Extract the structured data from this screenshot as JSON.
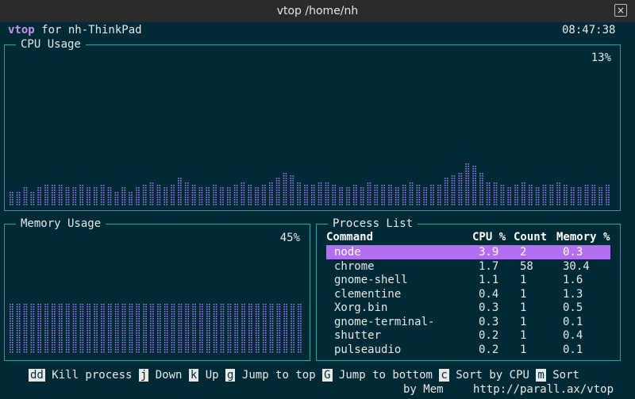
{
  "window": {
    "title": "vtop  /home/nh",
    "close_glyph": "×"
  },
  "header": {
    "app": "vtop",
    "host_text": " for nh-ThinkPad",
    "clock": "08:47:38"
  },
  "cpu": {
    "title": "CPU Usage",
    "percent_label": "13%",
    "history": [
      10,
      10,
      12,
      10,
      12,
      14,
      14,
      14,
      12,
      12,
      14,
      12,
      12,
      14,
      12,
      10,
      12,
      10,
      12,
      14,
      16,
      14,
      12,
      14,
      18,
      16,
      14,
      12,
      12,
      14,
      12,
      12,
      14,
      16,
      14,
      12,
      14,
      16,
      18,
      22,
      20,
      16,
      14,
      14,
      16,
      16,
      14,
      12,
      12,
      14,
      12,
      16,
      14,
      14,
      14,
      12,
      14,
      16,
      14,
      12,
      14,
      14,
      18,
      20,
      22,
      28,
      26,
      22,
      16,
      16,
      14,
      12,
      14,
      16,
      14,
      12,
      14,
      14,
      16,
      14,
      12,
      12,
      14,
      14,
      12,
      14
    ]
  },
  "memory": {
    "title": "Memory Usage",
    "percent_label": "45%",
    "history": [
      45,
      45,
      45,
      45,
      45,
      45,
      45,
      45,
      45,
      45,
      45,
      45,
      45,
      45,
      45,
      45,
      45,
      45,
      45,
      45,
      45,
      45,
      45,
      45,
      45,
      45,
      45,
      45,
      45,
      45,
      45,
      45,
      45,
      45,
      45,
      45,
      45,
      45,
      45,
      45,
      45,
      45
    ]
  },
  "processes": {
    "title": "Process List",
    "headers": {
      "command": "Command",
      "cpu": "CPU %",
      "count": "Count",
      "memory": "Memory %"
    },
    "rows": [
      {
        "command": "node",
        "cpu": "3.9",
        "count": "2",
        "memory": "0.3"
      },
      {
        "command": "chrome",
        "cpu": "1.7",
        "count": "58",
        "memory": "30.4"
      },
      {
        "command": "gnome-shell",
        "cpu": "1.1",
        "count": "1",
        "memory": "1.6"
      },
      {
        "command": "clementine",
        "cpu": "0.4",
        "count": "1",
        "memory": "1.3"
      },
      {
        "command": "Xorg.bin",
        "cpu": "0.3",
        "count": "1",
        "memory": "0.5"
      },
      {
        "command": "gnome-terminal-",
        "cpu": "0.3",
        "count": "1",
        "memory": "0.1"
      },
      {
        "command": "shutter",
        "cpu": "0.2",
        "count": "1",
        "memory": "0.4"
      },
      {
        "command": "pulseaudio",
        "cpu": "0.2",
        "count": "1",
        "memory": "0.1"
      }
    ]
  },
  "footer": {
    "kill_key": "dd",
    "kill_label": " Kill process ",
    "down_key": "j",
    "down_label": " Down ",
    "up_key": "k",
    "up_label": " Up ",
    "top_key": "g",
    "top_label": " Jump to top ",
    "bottom_key": "G",
    "bottom_label": " Jump to bottom ",
    "cpu_key": "c",
    "cpu_label": " Sort by CPU ",
    "mem_key": "m",
    "mem_label": " Sort",
    "mem_label_cont": "by Mem",
    "url": "http://parall.ax/vtop"
  },
  "colors": {
    "background": "#002b36",
    "border": "#2aa198",
    "graph": "#9d79f2",
    "selected": "#b26ff0",
    "accent": "#c792ea"
  }
}
